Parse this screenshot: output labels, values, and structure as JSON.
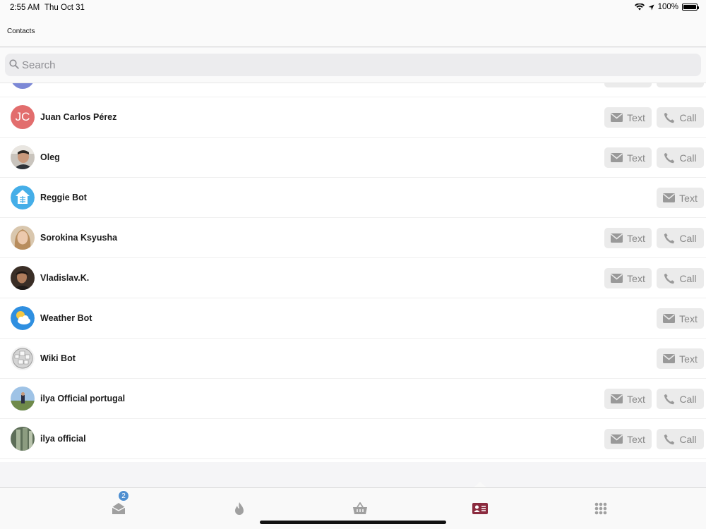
{
  "status": {
    "time": "2:55 AM",
    "date": "Thu Oct 31",
    "battery": "100%"
  },
  "header": {
    "title": "Contacts"
  },
  "search": {
    "placeholder": "Search"
  },
  "buttons": {
    "text_label": "Text",
    "call_label": "Call"
  },
  "contacts": [
    {
      "name": "Juan Carlos Pérez",
      "initials": "JC",
      "avatar": "initials-avatar",
      "actions": [
        "Text",
        "Call"
      ]
    },
    {
      "name": "Oleg",
      "avatar": "photo-avatar",
      "actions": [
        "Text",
        "Call"
      ]
    },
    {
      "name": "Reggie Bot",
      "avatar": "bot-house-icon",
      "actions": [
        "Text"
      ]
    },
    {
      "name": "Sorokina Ksyusha",
      "avatar": "photo-avatar",
      "actions": [
        "Text",
        "Call"
      ]
    },
    {
      "name": "Vladislav.K.",
      "avatar": "photo-avatar",
      "actions": [
        "Text",
        "Call"
      ]
    },
    {
      "name": "Weather Bot",
      "avatar": "weather-icon",
      "actions": [
        "Text"
      ]
    },
    {
      "name": "Wiki Bot",
      "avatar": "wiki-globe-icon",
      "actions": [
        "Text"
      ]
    },
    {
      "name": "ilya Official portugal",
      "avatar": "photo-avatar",
      "actions": [
        "Text",
        "Call"
      ]
    },
    {
      "name": "ilya official",
      "avatar": "photo-avatar",
      "actions": [
        "Text",
        "Call"
      ]
    }
  ],
  "tabbar": {
    "tabs": [
      {
        "icon": "inbox-icon",
        "badge": "2"
      },
      {
        "icon": "flame-icon"
      },
      {
        "icon": "basket-icon"
      },
      {
        "icon": "contacts-card-icon",
        "active": true
      },
      {
        "icon": "apps-grid-icon"
      }
    ]
  },
  "colors": {
    "accent": "#4f8fd0",
    "active_tab": "#8b2b3f",
    "initials_bg": "#e26d6d"
  }
}
